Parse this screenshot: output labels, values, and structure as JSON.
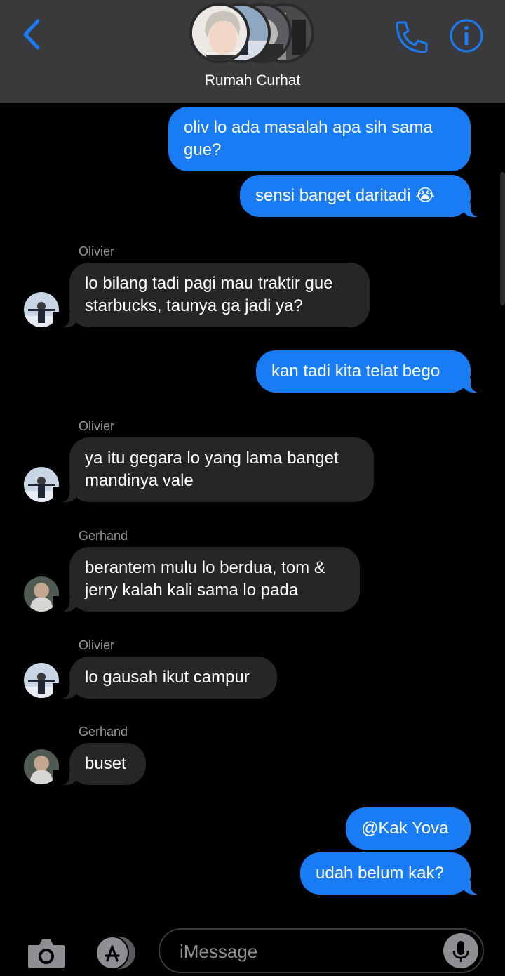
{
  "header": {
    "group_name": "Rumah Curhat"
  },
  "colors": {
    "accent": "#1a7cf5",
    "incoming_bubble": "#262628",
    "header_bg": "#3a3a3c",
    "sender_label": "#98989d"
  },
  "icons": {
    "back": "chevron-left-icon",
    "call": "phone-icon",
    "info": "info-icon",
    "camera": "camera-icon",
    "apps": "app-store-icon",
    "mic": "microphone-icon"
  },
  "messages": [
    {
      "direction": "outgoing",
      "lines": [
        "oliv lo ada masalah apa sih sama",
        "gue?"
      ]
    },
    {
      "direction": "outgoing",
      "lines": [
        "sensi banget daritadi 😭"
      ]
    },
    {
      "direction": "incoming",
      "sender": "Olivier",
      "lines": [
        "lo bilang tadi pagi mau traktir gue",
        "starbucks, taunya ga jadi ya?"
      ]
    },
    {
      "direction": "outgoing",
      "lines": [
        "kan tadi kita telat bego"
      ]
    },
    {
      "direction": "incoming",
      "sender": "Olivier",
      "lines": [
        "ya itu gegara lo yang lama banget",
        "mandinya vale"
      ]
    },
    {
      "direction": "incoming",
      "sender": "Gerhand",
      "lines": [
        "berantem mulu lo berdua, tom &",
        "jerry kalah kali sama lo pada"
      ]
    },
    {
      "direction": "incoming",
      "sender": "Olivier",
      "lines": [
        "lo gausah ikut campur"
      ]
    },
    {
      "direction": "incoming",
      "sender": "Gerhand",
      "lines": [
        "buset"
      ]
    },
    {
      "direction": "outgoing",
      "lines": [
        "@Kak Yova"
      ]
    },
    {
      "direction": "outgoing",
      "lines": [
        "udah belum kak?"
      ]
    }
  ],
  "composer": {
    "placeholder": "iMessage",
    "value": ""
  }
}
